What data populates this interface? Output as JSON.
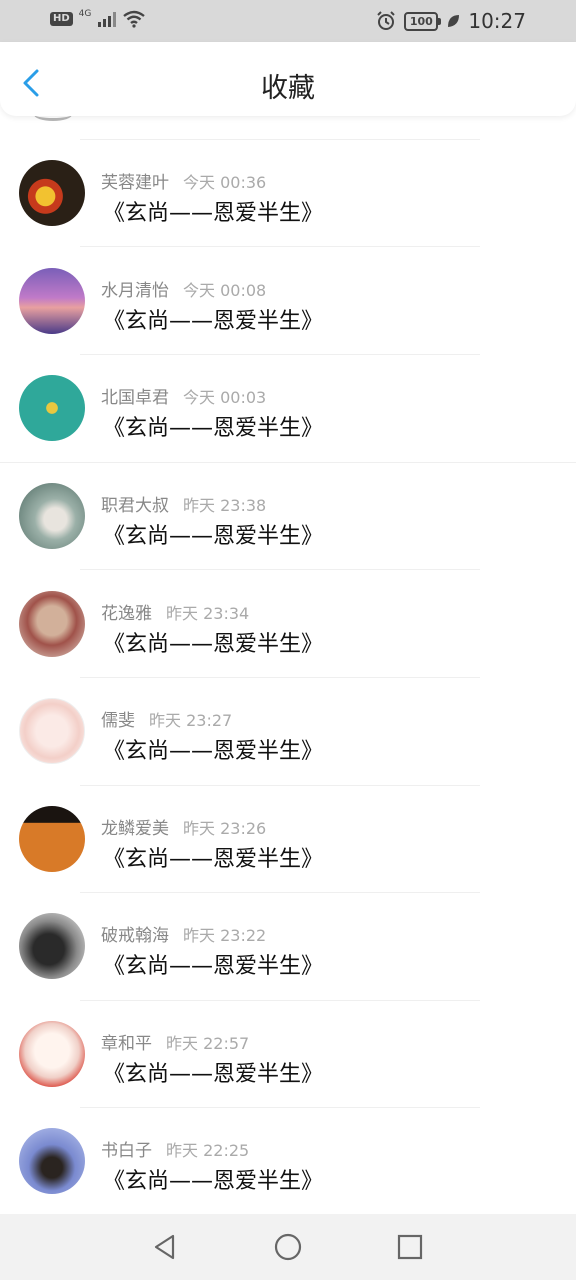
{
  "status_bar": {
    "hd": "HD",
    "network": "4G",
    "battery": "100",
    "time": "10:27"
  },
  "header": {
    "title": "收藏"
  },
  "items": [
    {
      "name": "芙蓉建叶",
      "time": "今天 00:36",
      "message": "《玄尚——恩爱半生》"
    },
    {
      "name": "水月清怡",
      "time": "今天 00:08",
      "message": "《玄尚——恩爱半生》"
    },
    {
      "name": "北国卓君",
      "time": "今天 00:03",
      "message": "《玄尚——恩爱半生》"
    },
    {
      "name": "职君大叔",
      "time": "昨天 23:38",
      "message": "《玄尚——恩爱半生》"
    },
    {
      "name": "花逸雅",
      "time": "昨天 23:34",
      "message": "《玄尚——恩爱半生》"
    },
    {
      "name": "儒斐",
      "time": "昨天 23:27",
      "message": "《玄尚——恩爱半生》"
    },
    {
      "name": "龙鳞爱美",
      "time": "昨天 23:26",
      "message": "《玄尚——恩爱半生》"
    },
    {
      "name": "破戒翰海",
      "time": "昨天 23:22",
      "message": "《玄尚——恩爱半生》"
    },
    {
      "name": "章和平",
      "time": "昨天 22:57",
      "message": "《玄尚——恩爱半生》"
    },
    {
      "name": "书白子",
      "time": "昨天 22:25",
      "message": "《玄尚——恩爱半生》"
    }
  ],
  "colors": {
    "accent": "#2a9ee8",
    "status_bar_bg": "#d9d9d9",
    "nav_bar_bg": "#f2f2f2"
  },
  "icons": [
    "back-arrow-icon",
    "alarm-icon",
    "leaf-icon",
    "signal-icon",
    "wifi-icon",
    "nav-back-icon",
    "nav-home-icon",
    "nav-recents-icon"
  ]
}
